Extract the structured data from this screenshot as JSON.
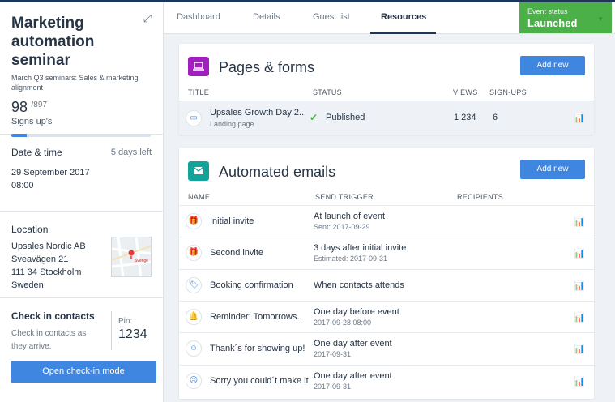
{
  "sidebar": {
    "title": "Marketing automation seminar",
    "subtitle": "March Q3 seminars: Sales & marketing alignment",
    "signups_count": "98",
    "signups_max": "/897",
    "signups_label": "Signs up's",
    "signups_progress": 0.11,
    "date_label": "Date & time",
    "days_left": "5 days left",
    "date_value": "29 September 2017",
    "time_value": "08:00",
    "location_label": "Location",
    "address": [
      "Upsales Nordic AB",
      "Sveavägen 21",
      "111 34 Stockholm",
      "Sweden"
    ],
    "map_label": "Sverige",
    "check_title": "Check in contacts",
    "check_desc": "Check in contacts as they arrive.",
    "pin_label": "Pin:",
    "pin_value": "1234",
    "checkin_button": "Open check-in mode"
  },
  "nav": {
    "tabs": [
      "Dashboard",
      "Details",
      "Guest list",
      "Resources"
    ],
    "active_tab": "Resources",
    "status_label": "Event status",
    "status_value": "Launched",
    "status_color": "#4cb049"
  },
  "pages_forms": {
    "title": "Pages & forms",
    "add_label": "Add new",
    "columns": [
      "TITLE",
      "STATUS",
      "VIEWS",
      "SIGN-UPS"
    ],
    "rows": [
      {
        "title": "Upsales Growth Day 2..",
        "subtitle": "Landing page",
        "status": "Published",
        "views": "1 234",
        "signups": "6"
      }
    ]
  },
  "emails": {
    "title": "Automated emails",
    "add_label": "Add new",
    "columns": [
      "NAME",
      "SEND TRIGGER",
      "RECIPIENTS"
    ],
    "rows": [
      {
        "icon": "gift-icon",
        "name": "Initial invite",
        "trigger": "At launch of event",
        "sub": "Sent: 2017-09-29"
      },
      {
        "icon": "gift-icon",
        "name": "Second invite",
        "trigger": "3 days after initial invite",
        "sub": "Estimated: 2017-09-31"
      },
      {
        "icon": "ticket-icon",
        "name": "Booking confirmation",
        "trigger": "When contacts attends",
        "sub": ""
      },
      {
        "icon": "bell-icon",
        "name": "Reminder: Tomorrows..",
        "trigger": "One day before event",
        "sub": "2017-09-28 08:00"
      },
      {
        "icon": "smile-icon",
        "name": "Thank´s for showing up!",
        "trigger": "One day after event",
        "sub": "2017-09-31"
      },
      {
        "icon": "sad-icon",
        "name": "Sorry you could´t make it",
        "trigger": "One day after event",
        "sub": "2017-09-31"
      }
    ]
  },
  "colors": {
    "accent": "#3f86e0",
    "forms_icon": "#a21fbf",
    "email_icon": "#12a39b"
  }
}
